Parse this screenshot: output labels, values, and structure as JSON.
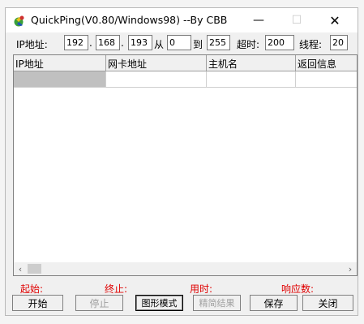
{
  "window": {
    "title": "QuickPing(V0.80/Windows98) --By CBB",
    "min_glyph": "—",
    "max_glyph": "☐",
    "close_glyph": "✕"
  },
  "toolbar": {
    "ip_label": "IP地址:",
    "ip1": "192",
    "dot1": ".",
    "ip2": "168",
    "dot2": ".",
    "ip3": "193",
    "from_label": "从",
    "from_value": "0",
    "to_label": "到",
    "to_value": "255",
    "timeout_label": "超时:",
    "timeout_value": "200",
    "threads_label": "线程:",
    "threads_value": "20"
  },
  "table": {
    "headers": [
      "IP地址",
      "网卡地址",
      "主机名",
      "返回信息"
    ],
    "rows": [
      [
        "",
        "",
        "",
        ""
      ]
    ]
  },
  "scrollbar": {
    "left_glyph": "‹",
    "right_glyph": "›"
  },
  "status": {
    "start_label": "起始:",
    "end_label": "终止:",
    "elapsed_label": "用时:",
    "responses_label": "响应数:"
  },
  "buttons": {
    "start": "开始",
    "stop": "停止",
    "graph_mode": "图形模式",
    "simplify": "精简结果",
    "save": "保存",
    "close": "关闭"
  },
  "colors": {
    "status_text": "#e00000",
    "selection": "#c0c0c0"
  }
}
